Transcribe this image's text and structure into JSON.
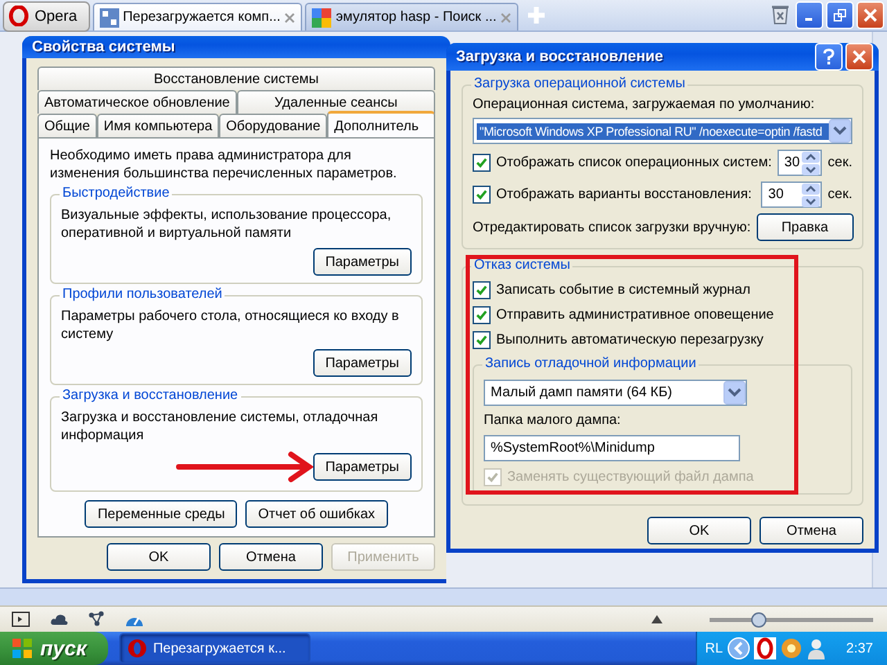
{
  "browser": {
    "menu_button": "Opera",
    "tabs": [
      {
        "title": "Перезагружается комп...",
        "selected": true
      },
      {
        "title": "эмулятор hasp - Поиск ...",
        "selected": false
      }
    ]
  },
  "system_properties": {
    "title": "Свойства системы",
    "tab_rows": [
      [
        {
          "label": "Восстановление системы",
          "selected": false
        }
      ],
      [
        {
          "label": "Автоматическое обновление",
          "selected": false
        },
        {
          "label": "Удаленные сеансы",
          "selected": false
        }
      ],
      [
        {
          "label": "Общие",
          "selected": false
        },
        {
          "label": "Имя компьютера",
          "selected": false
        },
        {
          "label": "Оборудование",
          "selected": false
        },
        {
          "label": "Дополнитель",
          "selected": true
        }
      ]
    ],
    "notice": "Необходимо иметь права администратора для изменения большинства перечисленных параметров.",
    "groups": [
      {
        "title": "Быстродействие",
        "description": "Визуальные эффекты, использование процессора, оперативной и виртуальной памяти",
        "button": "Параметры"
      },
      {
        "title": "Профили пользователей",
        "description": "Параметры рабочего стола, относящиеся ко входу в систему",
        "button": "Параметры"
      },
      {
        "title": "Загрузка и восстановление",
        "description": "Загрузка и восстановление системы, отладочная информация",
        "button": "Параметры"
      }
    ],
    "extra_buttons": [
      "Переменные среды",
      "Отчет об ошибках"
    ],
    "footer_buttons": [
      {
        "label": "OK",
        "disabled": false
      },
      {
        "label": "Отмена",
        "disabled": false
      },
      {
        "label": "Применить",
        "disabled": true
      }
    ]
  },
  "startup_recovery": {
    "title": "Загрузка и восстановление",
    "startup": {
      "title": "Загрузка операционной системы",
      "default_os_label": "Операционная система, загружаемая по умолчанию:",
      "default_os": "\"Microsoft Windows XP Professional RU\" /noexecute=optin /fastd",
      "options": [
        {
          "label": "Отображать список операционных систем:",
          "checked": true,
          "value": "30",
          "unit": "сек."
        },
        {
          "label": "Отображать варианты восстановления:",
          "checked": true,
          "value": "30",
          "unit": "сек."
        }
      ],
      "edit_label": "Отредактировать список загрузки вручную:",
      "edit_button": "Правка"
    },
    "failure": {
      "title": "Отказ системы",
      "options": [
        {
          "label": "Записать событие в системный журнал",
          "checked": true,
          "disabled": false
        },
        {
          "label": "Отправить административное оповещение",
          "checked": true,
          "disabled": false
        },
        {
          "label": "Выполнить автоматическую перезагрузку",
          "checked": true,
          "disabled": false
        }
      ],
      "debug": {
        "title": "Запись отладочной информации",
        "dump_type": "Малый дамп памяти (64 КБ)",
        "folder_label": "Папка малого дампа:",
        "folder": "%SystemRoot%\\Minidump",
        "overwrite": {
          "label": "Заменять существующий файл дампа",
          "checked": true,
          "disabled": true
        }
      }
    },
    "buttons": [
      "OK",
      "Отмена"
    ]
  },
  "status_bar": {
    "zoom": {
      "level": 0.3
    }
  },
  "taskbar": {
    "start": "пуск",
    "tasks": [
      {
        "title": "Перезагружается к...",
        "selected": true
      }
    ],
    "language": "RL",
    "time": "2:37"
  }
}
